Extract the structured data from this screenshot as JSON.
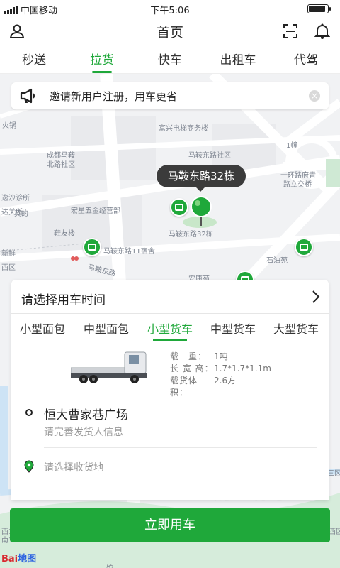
{
  "status_bar": {
    "carrier": "中国移动",
    "time": "下午5:06",
    "battery_level": 0.9
  },
  "header": {
    "title": "首页",
    "icons": [
      "user-icon",
      "scan-icon",
      "bell-icon"
    ]
  },
  "tabs": [
    {
      "label": "秒送",
      "active": false
    },
    {
      "label": "拉货",
      "active": true
    },
    {
      "label": "快车",
      "active": false
    },
    {
      "label": "出租车",
      "active": false
    },
    {
      "label": "代驾",
      "active": false
    }
  ],
  "notice": {
    "text": "邀请新用户注册，用车更省",
    "close_icon": "×"
  },
  "map": {
    "pin_label": "马鞍东路32栋",
    "labels": [
      "火锅",
      "富兴电梯商务楼",
      "1幢",
      "成都马鞍",
      "北路社区",
      "马鞍东路社区",
      "一环路府青",
      "路立交桥",
      "逸沙诊所",
      "达关所",
      "宏星五金经营部",
      "黄的",
      "鞋友楼",
      "马鞍东路32栋",
      "新鲜",
      "马鞍东路11宿舍",
      "石油苑",
      "西区",
      "马鞍东路",
      "安康苑",
      "西1",
      "南1",
      "三区",
      "西区",
      "馆"
    ],
    "provider": {
      "part1": "Bai",
      "part2": "地图"
    }
  },
  "card": {
    "time_select": "请选择用车时间",
    "vehicle_types": [
      {
        "label": "小型面包",
        "active": false
      },
      {
        "label": "中型面包",
        "active": false
      },
      {
        "label": "小型货车",
        "active": true
      },
      {
        "label": "中型货车",
        "active": false
      },
      {
        "label": "大型货车",
        "active": false
      }
    ],
    "specs": [
      {
        "key": "载　重：",
        "value": "1吨"
      },
      {
        "key": "长 宽 高：",
        "value": "1.7*1.7*1.1m"
      },
      {
        "key": "载货体积：",
        "value": "2.6方"
      }
    ],
    "pickup": {
      "title": "恒大曹家巷广场",
      "subtitle": "请完善发货人信息"
    },
    "dropoff": {
      "placeholder": "请选择收货地"
    }
  },
  "cta": {
    "label": "立即用车"
  },
  "colors": {
    "accent": "#1fa83a",
    "tooltip": "#3b3b3b"
  }
}
